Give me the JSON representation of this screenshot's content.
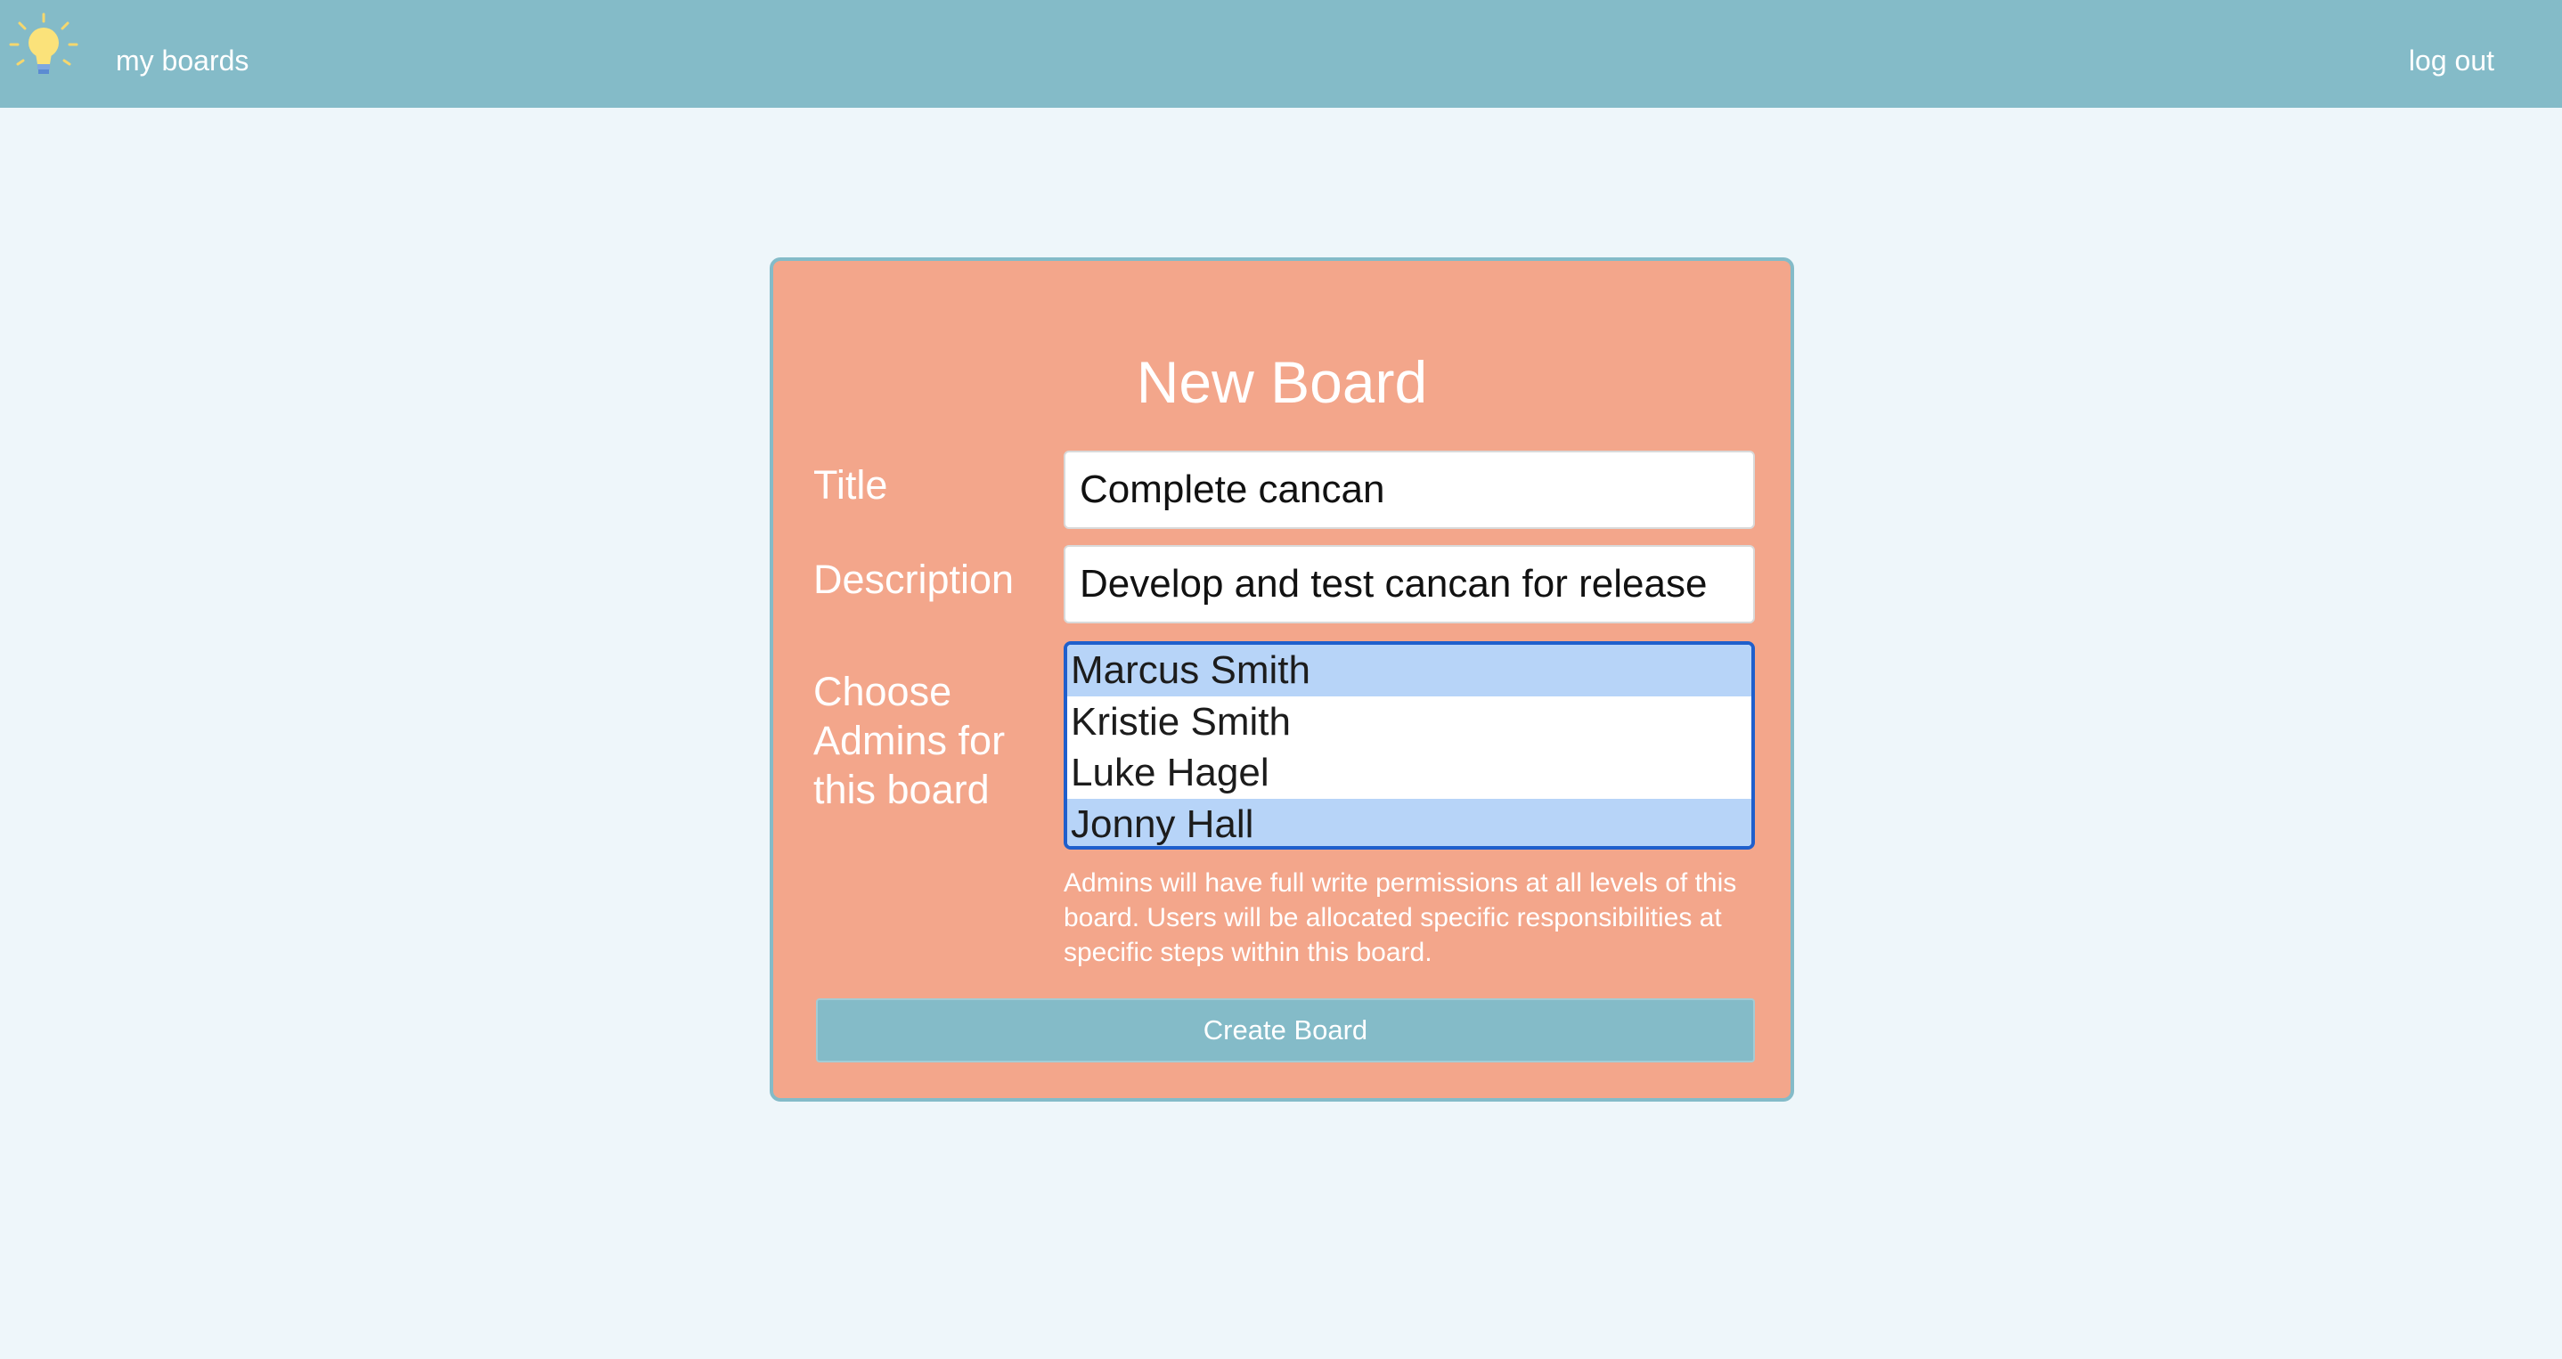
{
  "nav": {
    "logo_icon": "lightbulb-icon",
    "my_boards": "my boards",
    "log_out": "log out"
  },
  "form": {
    "heading": "New Board",
    "title_label": "Title",
    "title_value": "Complete cancan",
    "description_label": "Description",
    "description_value": "Develop and test cancan for release",
    "admins_label": "Choose Admins for this board",
    "admins_options": [
      {
        "name": "Marcus Smith",
        "selected": true
      },
      {
        "name": "Kristie Smith",
        "selected": false
      },
      {
        "name": "Luke Hagel",
        "selected": false
      },
      {
        "name": "Jonny Hall",
        "selected": true
      }
    ],
    "help_text": "Admins will have full write permissions at all levels of this board. Users will be allocated specific responsibilities at specific steps within this board.",
    "submit_label": "Create Board"
  },
  "colors": {
    "navbar": "#84bbc8",
    "background": "#eef6fa",
    "card": "#f3a68b",
    "selected_option": "#b7d4f8",
    "listbox_focus": "#1f5fcc"
  }
}
